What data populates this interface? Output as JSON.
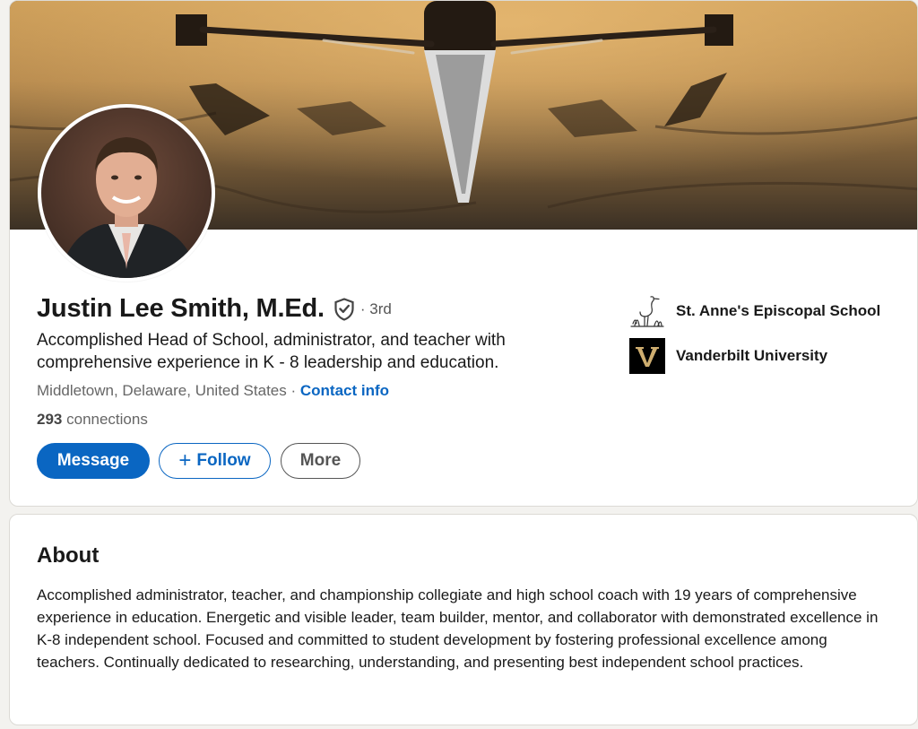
{
  "profile": {
    "name": "Justin Lee Smith, M.Ed.",
    "degree": "· 3rd",
    "headline": "Accomplished Head of School, administrator, and teacher with comprehensive experience in K - 8 leadership and education.",
    "location": "Middletown, Delaware, United States",
    "separator": "·",
    "contact_info": "Contact info",
    "connections_count": "293",
    "connections_label": "connections",
    "icons": {
      "verified": "shield-check-icon",
      "banner": "rowing-banner-image",
      "avatar": "profile-photo"
    }
  },
  "actions": {
    "message": "Message",
    "follow_plus": "+",
    "follow": "Follow",
    "more": "More"
  },
  "organizations": [
    {
      "name": "St. Anne's Episcopal School",
      "logo": "heron-logo-icon"
    },
    {
      "name": "Vanderbilt University",
      "logo": "vanderbilt-v-logo-icon"
    }
  ],
  "about": {
    "title": "About",
    "text": "Accomplished administrator, teacher, and championship collegiate and high school coach with 19 years of comprehensive experience in education. Energetic and visible leader, team builder, mentor, and collaborator with demonstrated excellence in K-8 independent school. Focused and committed to student development by fostering professional excellence among teachers. Continually dedicated to researching, understanding, and presenting best independent school practices."
  },
  "colors": {
    "primary": "#0a66c2",
    "page_bg": "#f3f2ef",
    "card_bg": "#ffffff",
    "secondary_text": "#666666",
    "vanderbilt_gold": "#cfae70"
  }
}
